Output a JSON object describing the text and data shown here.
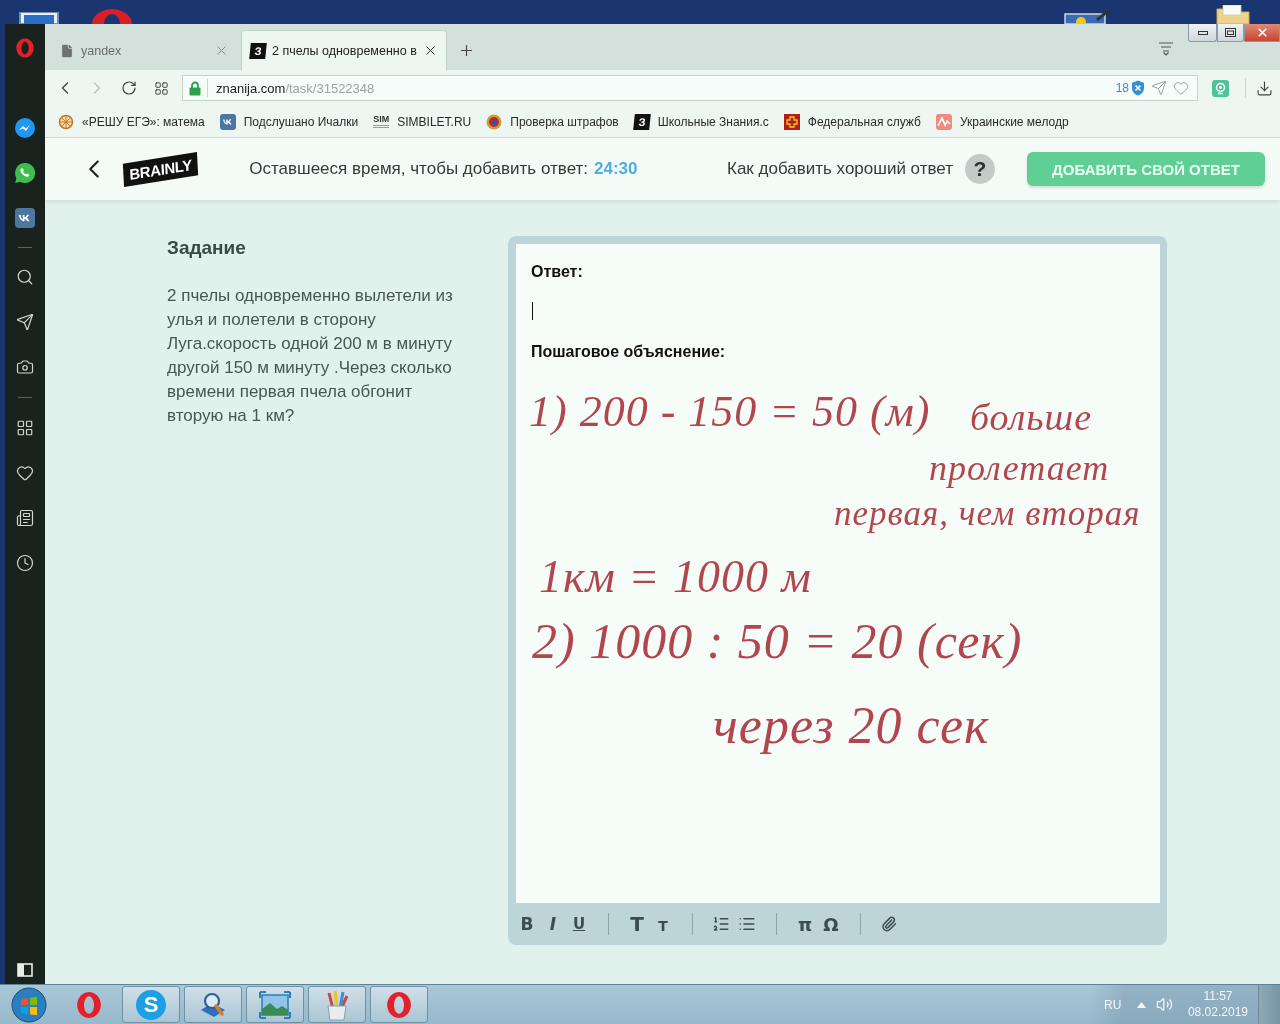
{
  "browser": {
    "tabs": [
      {
        "kind": "page",
        "title": "yandex",
        "selected": false
      },
      {
        "kind": "site",
        "logo": "З",
        "title": "2 пчелы одновременно в",
        "selected": true
      }
    ],
    "address": {
      "host": "znanija.com",
      "path": "/task/31522348",
      "blocked_count": "18"
    },
    "bookmarks": [
      {
        "kind": "sun",
        "label": "«РЕШУ ЕГЭ»: матема"
      },
      {
        "kind": "social",
        "label": "Подслушано Ичалки"
      },
      {
        "kind": "text-logo",
        "logo": "SIM",
        "label": "SIMBILET.RU"
      },
      {
        "kind": "emblem",
        "label": "Проверка штрафов"
      },
      {
        "kind": "site",
        "logo": "З",
        "label": "Школьные Знания.c"
      },
      {
        "kind": "cross",
        "label": "Федеральная служб"
      },
      {
        "kind": "chart",
        "label": "Украинские мелодр"
      }
    ]
  },
  "header": {
    "logo": "BRAINLY",
    "timer_label": "Оставшееся время, чтобы добавить ответ:",
    "timer": "24:30",
    "help_link": "Как добавить хороший ответ",
    "help_icon": "?",
    "add_button": "ДОБАВИТЬ СВОЙ ОТВЕТ"
  },
  "task": {
    "heading": "Задание",
    "text": "2 пчелы одновременно вылетели из улья и полетели в сторону Луга.скорость одной 200 м в минуту другой 150 м минуту .Через сколько времени первая пчела обгонит вторую на 1 км?"
  },
  "editor": {
    "answer_label": "Ответ:",
    "explanation_label": "Пошаговое объяснение:",
    "toolbar": [
      [
        {
          "kind": "bold",
          "label": "B"
        },
        {
          "kind": "italic",
          "label": "I"
        },
        {
          "kind": "underline",
          "label": "U"
        }
      ],
      [
        {
          "kind": "large",
          "label": "T"
        },
        {
          "kind": "small",
          "label": "T"
        }
      ],
      [
        {
          "kind": "ordered-list"
        },
        {
          "kind": "bullet-list"
        }
      ],
      [
        {
          "kind": "symbol",
          "label": "π"
        },
        {
          "kind": "symbol",
          "label": "Ω"
        }
      ],
      [
        {
          "kind": "attach"
        }
      ]
    ]
  },
  "handwriting": [
    "1) 200 - 150 = 50 (м)",
    "больше",
    "пролетает",
    "первая, чем вторая",
    "1км = 1000 м",
    "2) 1000 : 50 = 20 (сек)",
    "через 20 сек"
  ],
  "taskbar": {
    "apps": [
      {
        "kind": "opera",
        "running": false
      },
      {
        "kind": "skype",
        "logo": "S",
        "running": true
      },
      {
        "kind": "search",
        "running": true
      },
      {
        "kind": "photos",
        "running": true
      },
      {
        "kind": "paint",
        "running": true
      },
      {
        "kind": "opera",
        "running": true
      }
    ],
    "language": "RU",
    "time": "11:57",
    "date": "08.02.2019"
  }
}
